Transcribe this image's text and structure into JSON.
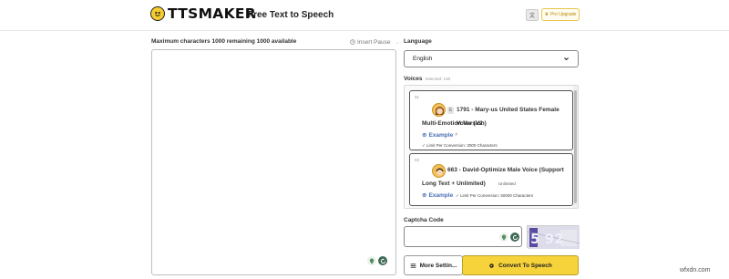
{
  "header": {
    "brand": "TTSMAKER",
    "tagline": "Free Text to Speech",
    "language_switch_icon": "translate-icon",
    "pro_upgrade_label": "Pro Upgrade"
  },
  "editor": {
    "limit_text": "Maximum characters 1000 remaining 1000 available",
    "insert_pause_label": "Insert Pause",
    "text": ""
  },
  "language": {
    "label": "Language",
    "selected": "English"
  },
  "voices": {
    "label": "Voices",
    "sub_label": "Selected: 148",
    "items": [
      {
        "num": "01",
        "tag": "E",
        "title_line1": "1791 - Mary-us United States Female Voice (V2",
        "title_line2": "Multi-Emotion Version)",
        "example_label": "Example",
        "limit_note": "Limit Per Conversion: 3000 Characters"
      },
      {
        "num": "02",
        "title_line1": "663 - David-Optimize Male Voice (Support",
        "title_line2": "Long Text + Unlimited)",
        "unlimited_label": "Unlimited",
        "example_label": "Example",
        "limit_note": "Limit Per Conversion: 50000 Characters"
      }
    ]
  },
  "captcha": {
    "label": "Captcha Code",
    "value": "",
    "image_text": "5 92"
  },
  "actions": {
    "more_settings_label": "More Settin...",
    "convert_label": "Convert To Speech"
  },
  "watermark": "wfxdn.com",
  "colors": {
    "accent_yellow": "#f6d33a",
    "link_blue": "#4a6fb5",
    "border": "#bfbfbf"
  }
}
